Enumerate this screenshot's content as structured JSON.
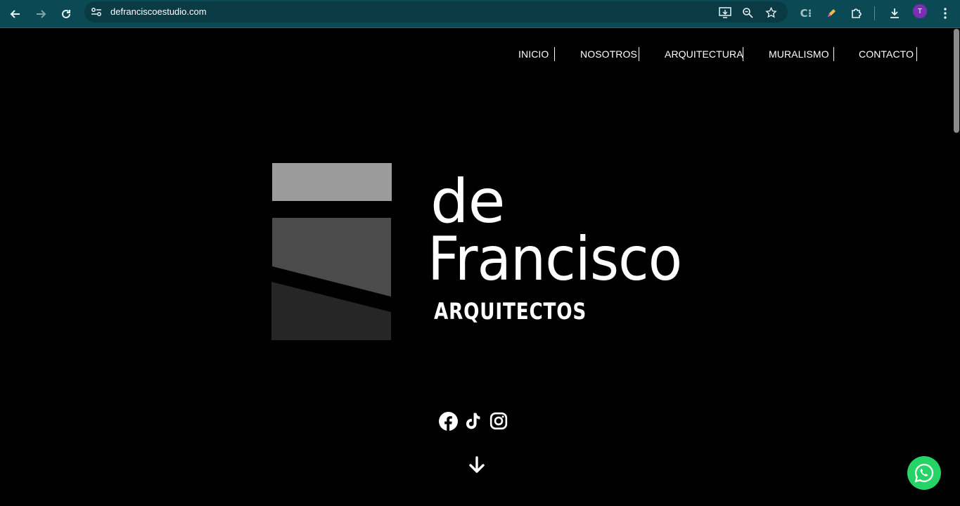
{
  "browser": {
    "url": "defranciscoestudio.com",
    "profile_initial": "T",
    "icons": [
      "back-arrow-icon",
      "forward-arrow-icon",
      "reload-icon",
      "site-info-icon",
      "install-app-icon",
      "zoom-icon",
      "bookmark-star-icon",
      "extension-c-icon",
      "pencil-extension-icon",
      "puzzle-extensions-icon",
      "download-icon",
      "menu-kebab-icon"
    ]
  },
  "nav": {
    "items": [
      {
        "label": "INICIO"
      },
      {
        "label": "NOSOTROS"
      },
      {
        "label": "ARQUITECTURA"
      },
      {
        "label": "MURALISMO"
      },
      {
        "label": "CONTACTO"
      }
    ]
  },
  "logo": {
    "line1": "de",
    "line2": "Francisco",
    "line3": "ARQUITECTOS",
    "colors": {
      "top_block": "#9b9b9c",
      "middle_block": "#4b4b4c",
      "bottom_block": "#262627"
    }
  },
  "social": {
    "icons": [
      "facebook-icon",
      "tiktok-icon",
      "instagram-icon"
    ]
  },
  "colors": {
    "chrome": "#0b4a55",
    "background": "#000000",
    "whatsapp": "#25d366"
  }
}
